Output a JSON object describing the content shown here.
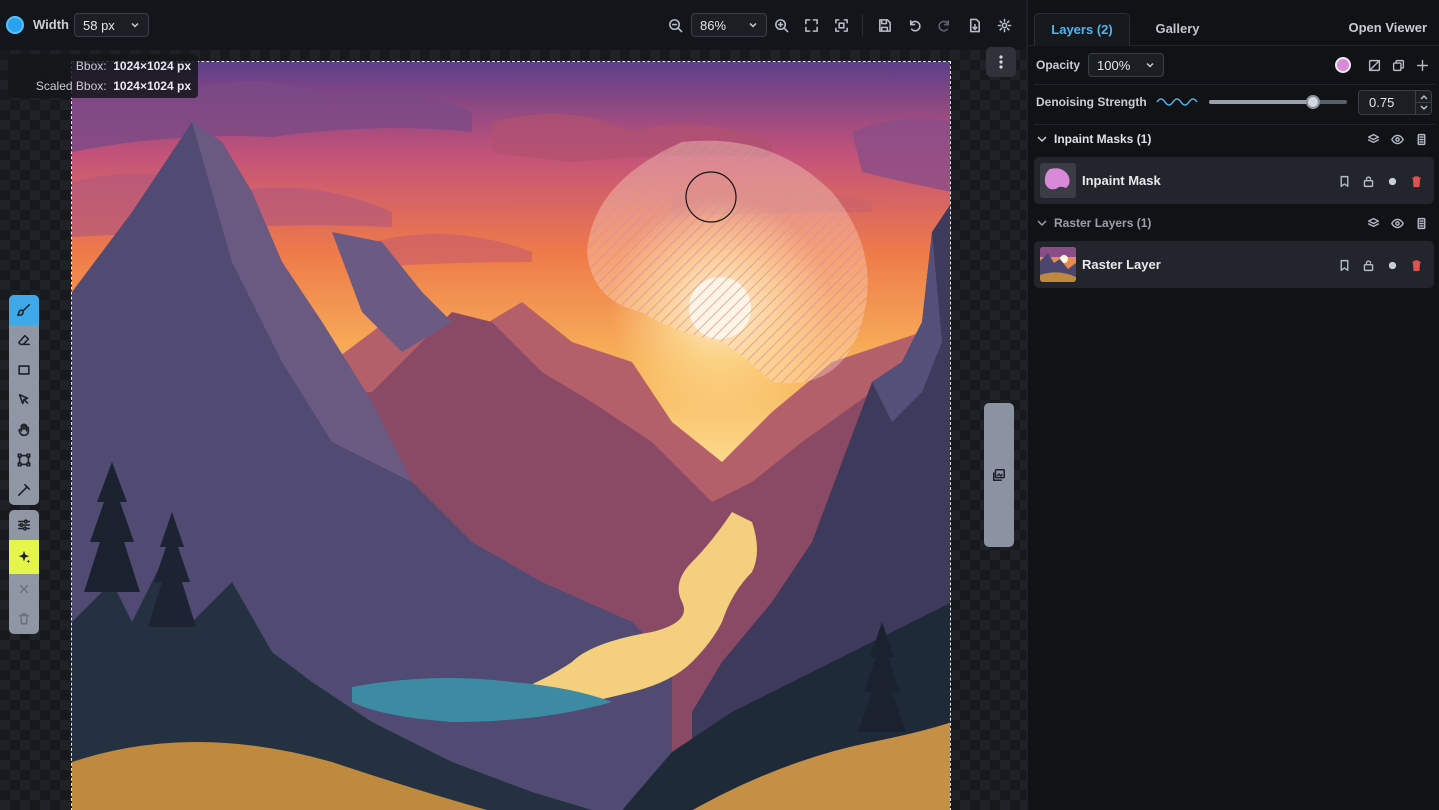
{
  "toolbar": {
    "brush_color": "#2aa3ee",
    "width_label": "Width",
    "width_value": "58 px",
    "zoom_value": "86%"
  },
  "canvas": {
    "bbox_label": "Bbox:",
    "bbox_value": "1024×1024 px",
    "scaled_bbox_label": "Scaled Bbox:",
    "scaled_bbox_value": "1024×1024 px"
  },
  "tools": [
    "brush-icon",
    "eraser-icon",
    "rect-icon",
    "move-icon",
    "hand-icon",
    "transform-icon",
    "color-picker-icon",
    "filters-icon",
    "invoke-icon",
    "close-icon",
    "trash-icon"
  ],
  "panel": {
    "tabs": {
      "layers": "Layers (2)",
      "gallery": "Gallery",
      "open_viewer": "Open Viewer"
    },
    "opacity_label": "Opacity",
    "opacity_value": "100%",
    "mask_color": "#d88ad8",
    "denoise_label": "Denoising Strength",
    "denoise_value": "0.75",
    "denoise_fraction": 0.75,
    "inpaint_group": "Inpaint Masks (1)",
    "inpaint_layer": "Inpaint Mask",
    "raster_group": "Raster Layers (1)",
    "raster_layer": "Raster Layer"
  },
  "colors": {
    "accent": "#4bb6f2",
    "invoke": "#e6f54a",
    "danger": "#e0524f"
  }
}
